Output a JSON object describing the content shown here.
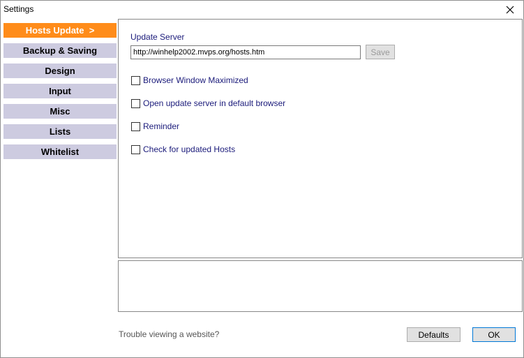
{
  "window": {
    "title": "Settings",
    "close_icon": "close-icon"
  },
  "sidebar": {
    "items": [
      {
        "label": "Hosts Update  >",
        "active": true
      },
      {
        "label": "Backup & Saving",
        "active": false
      },
      {
        "label": "Design",
        "active": false
      },
      {
        "label": "Input",
        "active": false
      },
      {
        "label": "Misc",
        "active": false
      },
      {
        "label": "Lists",
        "active": false
      },
      {
        "label": "Whitelist",
        "active": false
      }
    ]
  },
  "hosts_update": {
    "section_label": "Update Server",
    "server_url": "http://winhelp2002.mvps.org/hosts.htm",
    "save_label": "Save",
    "options": [
      {
        "label": "Browser Window Maximized",
        "checked": false
      },
      {
        "label": "Open update server in default browser",
        "checked": false
      },
      {
        "label": "Reminder",
        "checked": false
      },
      {
        "label": "Check for updated Hosts",
        "checked": false
      }
    ]
  },
  "footer": {
    "trouble_text": "Trouble viewing a website?",
    "defaults_label": "Defaults",
    "ok_label": "OK"
  },
  "colors": {
    "active_tab": "#ff8c1a",
    "inactive_tab": "#cdcbe0",
    "label_text": "#1a1a7a"
  }
}
